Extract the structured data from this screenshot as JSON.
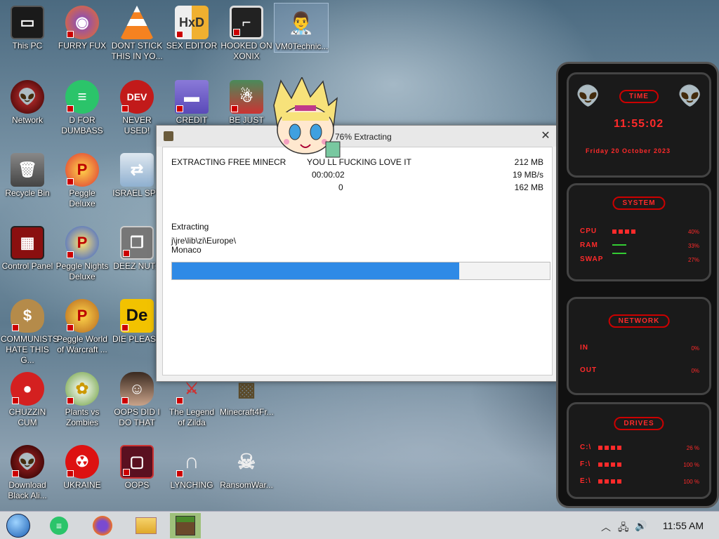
{
  "desktop": {
    "icons": [
      {
        "label": "This PC",
        "icon": "computer-icon"
      },
      {
        "label": "FURRY FUX",
        "icon": "firefox-icon"
      },
      {
        "label": "DONT STICK THIS IN YO...",
        "icon": "vlc-cone-icon"
      },
      {
        "label": "SEX EDITOR",
        "icon": "hxd-icon"
      },
      {
        "label": "HOOKED ON XONIX",
        "icon": "xonix-icon"
      },
      {
        "label": "VM0Technic...",
        "icon": "doctor-icon"
      },
      {
        "label": "Network",
        "icon": "alien-icon"
      },
      {
        "label": "D FOR DUMBASS",
        "icon": "chat-icon"
      },
      {
        "label": "NEVER USED!",
        "icon": "devcpp-icon"
      },
      {
        "label": "CREDIT CARD",
        "icon": "credit-card-icon"
      },
      {
        "label": "BE JUST LIKE",
        "icon": "elf-icon"
      },
      {
        "label": "Recycle Bin",
        "icon": "recycle-bin-icon"
      },
      {
        "label": "Peggle Deluxe",
        "icon": "peggle-icon"
      },
      {
        "label": "ISRAEL SPY",
        "icon": "spy-icon"
      },
      {
        "label": "Control Panel",
        "icon": "control-panel-icon"
      },
      {
        "label": "Peggle Nights Deluxe",
        "icon": "peggle-nights-icon"
      },
      {
        "label": "DEEZ NUTZ",
        "icon": "stack-icon"
      },
      {
        "label": "COMMUNISTS HATE THIS G...",
        "icon": "money-bag-icon"
      },
      {
        "label": "Peggle World of Warcraft ...",
        "icon": "peggle-wow-icon"
      },
      {
        "label": "DIE PLEASE",
        "icon": "de-icon"
      },
      {
        "label": "CHUZZIN CUM",
        "icon": "chuzzle-icon"
      },
      {
        "label": "Plants vs Zombies",
        "icon": "flower-icon"
      },
      {
        "label": "OOPS DID I DO THAT",
        "icon": "portrait-icon"
      },
      {
        "label": "The Legend of Zilda",
        "icon": "zelda-icon"
      },
      {
        "label": "Minecraft4Fr...",
        "icon": "minecraft-icon"
      },
      {
        "label": "Download Black Ali...",
        "icon": "alien-dark-icon"
      },
      {
        "label": "UKRAINE",
        "icon": "radiation-icon"
      },
      {
        "label": "OOPS",
        "icon": "box-icon"
      },
      {
        "label": "LYNCHING",
        "icon": "noose-icon"
      },
      {
        "label": "RansomWar...",
        "icon": "skull-icon"
      }
    ]
  },
  "dialog": {
    "title": "76% Extracting",
    "close_glyph": "✕",
    "task_name": "EXTRACTING FREE MINECR",
    "task_name_tail": "YOU    LL FUCKING LOVE IT",
    "elapsed": "00:00:02",
    "remaining_value": "0",
    "size_total": "212 MB",
    "speed": "19 MB/s",
    "processed": "162 MB",
    "status_label": "Extracting",
    "current_path": "j\\jre\\lib\\zi\\Europe\\",
    "current_file": "Monaco",
    "progress_percent": 76
  },
  "widget": {
    "time_title": "TIME",
    "time": "11:55:02",
    "date": "Friday 20 October 2023",
    "system_title": "SYSTEM",
    "cpu_label": "CPU",
    "cpu_value": "40%",
    "cpu_level": 40,
    "ram_label": "RAM",
    "ram_value": "33%",
    "swap_label": "SWAP",
    "swap_value": "27%",
    "network_title": "NETWORK",
    "in_label": "IN",
    "in_value": "0%",
    "out_label": "OUT",
    "out_value": "0%",
    "drives_title": "DRIVES",
    "drives": [
      {
        "label": "C:\\",
        "value": "26 %"
      },
      {
        "label": "F:\\",
        "value": "100 %"
      },
      {
        "label": "E:\\",
        "value": "100 %"
      }
    ]
  },
  "taskbar": {
    "items": [
      "start-orb-icon",
      "chat-icon",
      "firefox-icon",
      "file-explorer-icon",
      "minecraft-icon"
    ],
    "tray_chevron": "︿",
    "clock": "11:55 AM"
  },
  "colors": {
    "progress": "#2f8ae6",
    "widget_red": "#ff2a2a",
    "taskbar": "#d6d9dc",
    "active_task": "#9ec07a"
  }
}
